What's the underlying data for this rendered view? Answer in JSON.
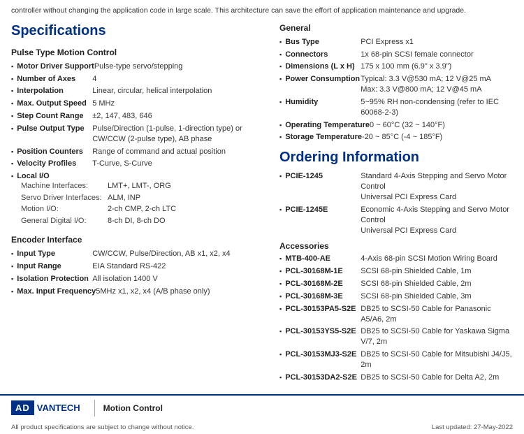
{
  "top_text": "controller without changing the application code in large scale. This architecture can save the effort of application maintenance and upgrade.",
  "specifications": {
    "title": "Specifications",
    "pulse_type": {
      "heading": "Pulse Type Motion Control",
      "items": [
        {
          "label": "Motor Driver Support",
          "value": "Pulse-type servo/stepping"
        },
        {
          "label": "Number of Axes",
          "value": "4"
        },
        {
          "label": "Interpolation",
          "value": "Linear, circular, helical interpolation"
        },
        {
          "label": "Max. Output Speed",
          "value": "5 MHz"
        },
        {
          "label": "Step Count Range",
          "value": "±2, 147, 483, 646"
        },
        {
          "label": "Pulse Output Type",
          "value": "Pulse/Direction (1-pulse, 1-direction type) or CW/CCW (2-pulse type), AB phase"
        },
        {
          "label": "Position Counters",
          "value": "Range of command and actual position"
        },
        {
          "label": "Velocity Profiles",
          "value": "T-Curve, S-Curve"
        }
      ],
      "local_io": {
        "label": "Local I/O",
        "sub_items": [
          {
            "label": "Machine Interfaces:",
            "value": "LMT+, LMT-, ORG"
          },
          {
            "label": "Servo Driver Interfaces:",
            "value": "ALM, INP"
          },
          {
            "label": "Motion I/O:",
            "value": "2-ch CMP, 2-ch LTC"
          },
          {
            "label": "General Digital I/O:",
            "value": "8-ch DI, 8-ch DO"
          }
        ]
      }
    },
    "encoder": {
      "heading": "Encoder Interface",
      "items": [
        {
          "label": "Input Type",
          "value": "CW/CCW, Pulse/Direction, AB x1, x2, x4"
        },
        {
          "label": "Input Range",
          "value": "EIA Standard RS-422"
        },
        {
          "label": "Isolation Protection",
          "value": "All isolation 1400 V"
        },
        {
          "label": "Max. Input Frequency",
          "value": "5MHz x1, x2, x4 (A/B phase only)"
        }
      ]
    }
  },
  "general": {
    "heading": "General",
    "items": [
      {
        "label": "Bus Type",
        "value": "PCI Express x1"
      },
      {
        "label": "Connectors",
        "value": "1x 68-pin SCSI female connector"
      },
      {
        "label": "Dimensions (L x H)",
        "value": "175 x 100 mm (6.9\" x 3.9\")"
      },
      {
        "label": "Power Consumption",
        "value": "Typical: 3.3 V@530 mA; 12 V@25 mA\nMax: 3.3 V@800 mA; 12 V@45 mA"
      },
      {
        "label": "Humidity",
        "value": "5~95% RH non-condensing (refer to IEC 60068-2-3)"
      },
      {
        "label": "Operating Temperature",
        "value": "0 ~ 60°C (32 ~ 140°F)"
      },
      {
        "label": "Storage Temperature",
        "value": "-20 ~ 85°C (-4 ~ 185°F)"
      }
    ]
  },
  "ordering": {
    "title": "Ordering Information",
    "items": [
      {
        "label": "PCIE-1245",
        "value": "Standard 4-Axis Stepping and Servo Motor Control\nUniversal PCI Express Card"
      },
      {
        "label": "PCIE-1245E",
        "value": "Economic 4-Axis Stepping and Servo Motor Control\nUniversal PCI Express Card"
      }
    ]
  },
  "accessories": {
    "heading": "Accessories",
    "items": [
      {
        "label": "MTB-400-AE",
        "value": "4-Axis 68-pin SCSI Motion Wiring Board"
      },
      {
        "label": "PCL-30168M-1E",
        "value": "SCSI 68-pin Shielded Cable, 1m"
      },
      {
        "label": "PCL-30168M-2E",
        "value": "SCSI 68-pin Shielded Cable, 2m"
      },
      {
        "label": "PCL-30168M-3E",
        "value": "SCSI 68-pin Shielded Cable, 3m"
      },
      {
        "label": "PCL-30153PA5-S2E",
        "value": "DB25 to SCSI-50 Cable for Panasonic A5/A6, 2m"
      },
      {
        "label": "PCL-30153YS5-S2E",
        "value": "DB25 to SCSI-50 Cable for Yaskawa Sigma V/7, 2m"
      },
      {
        "label": "PCL-30153MJ3-S2E",
        "value": "DB25 to SCSI-50 Cable for Mitsubishi J4/J5, 2m"
      },
      {
        "label": "PCL-30153DA2-S2E",
        "value": "DB25 to SCSI-50 Cable for Delta A2, 2m"
      }
    ]
  },
  "footer": {
    "logo_adv": "AD",
    "logo_vantech": "VANTECH",
    "category": "Motion Control",
    "disclaimer": "All product specifications are subject to change without notice.",
    "last_updated": "Last updated: 27-May-2022"
  }
}
